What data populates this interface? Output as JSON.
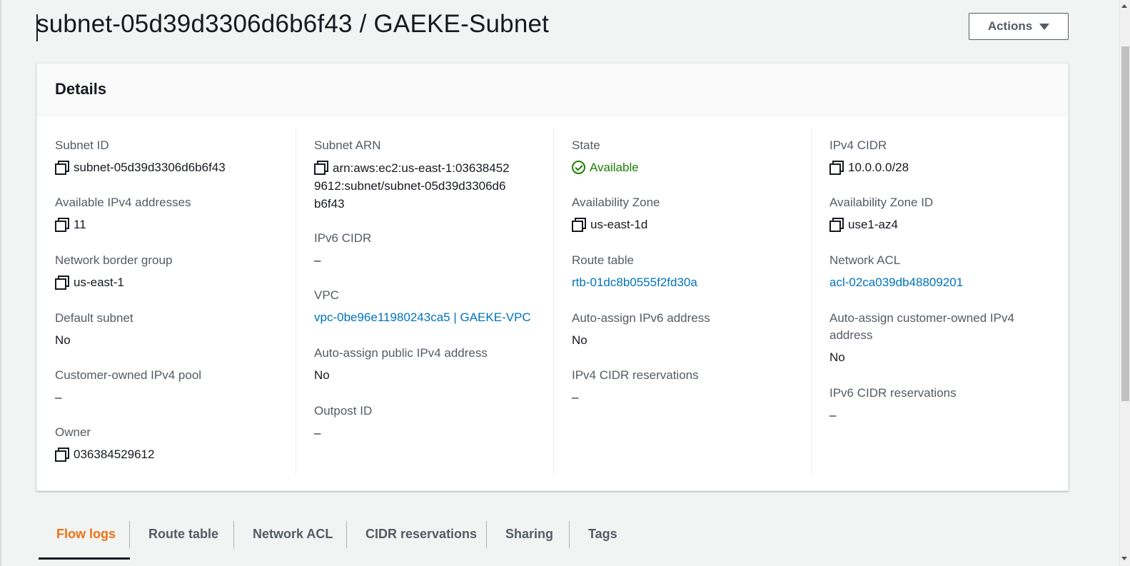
{
  "page": {
    "title": "subnet-05d39d3306d6b6f43 / GAEKE-Subnet",
    "actions_label": "Actions"
  },
  "details": {
    "header": "Details",
    "col1": {
      "subnet_id": {
        "label": "Subnet ID",
        "value": "subnet-05d39d3306d6b6f43"
      },
      "available_ipv4": {
        "label": "Available IPv4 addresses",
        "value": "11"
      },
      "network_border_group": {
        "label": "Network border group",
        "value": "us-east-1"
      },
      "default_subnet": {
        "label": "Default subnet",
        "value": "No"
      },
      "customer_owned_pool": {
        "label": "Customer-owned IPv4 pool",
        "value": "–"
      },
      "owner": {
        "label": "Owner",
        "value": "036384529612"
      }
    },
    "col2": {
      "subnet_arn": {
        "label": "Subnet ARN",
        "value": "arn:aws:ec2:us-east-1:036384529612:subnet/subnet-05d39d3306d6b6f43"
      },
      "ipv6_cidr": {
        "label": "IPv6 CIDR",
        "value": "–"
      },
      "vpc": {
        "label": "VPC",
        "value": "vpc-0be96e11980243ca5 | GAEKE-VPC"
      },
      "auto_assign_public_ipv4": {
        "label": "Auto-assign public IPv4 address",
        "value": "No"
      },
      "outpost_id": {
        "label": "Outpost ID",
        "value": "–"
      }
    },
    "col3": {
      "state": {
        "label": "State",
        "value": "Available"
      },
      "availability_zone": {
        "label": "Availability Zone",
        "value": "us-east-1d"
      },
      "route_table": {
        "label": "Route table",
        "value": "rtb-01dc8b0555f2fd30a"
      },
      "auto_assign_ipv6": {
        "label": "Auto-assign IPv6 address",
        "value": "No"
      },
      "ipv4_cidr_reservations": {
        "label": "IPv4 CIDR reservations",
        "value": "–"
      }
    },
    "col4": {
      "ipv4_cidr": {
        "label": "IPv4 CIDR",
        "value": "10.0.0.0/28"
      },
      "availability_zone_id": {
        "label": "Availability Zone ID",
        "value": "use1-az4"
      },
      "network_acl": {
        "label": "Network ACL",
        "value": "acl-02ca039db48809201"
      },
      "auto_assign_customer_owned": {
        "label": "Auto-assign customer-owned IPv4 address",
        "value": "No"
      },
      "ipv6_cidr_reservations": {
        "label": "IPv6 CIDR reservations",
        "value": "–"
      }
    }
  },
  "tabs": [
    {
      "label": "Flow logs",
      "active": true
    },
    {
      "label": "Route table"
    },
    {
      "label": "Network ACL"
    },
    {
      "label": "CIDR reservations"
    },
    {
      "label": "Sharing"
    },
    {
      "label": "Tags"
    }
  ],
  "colors": {
    "link": "#0073bb",
    "status_ok": "#1d8102",
    "active_tab": "#ec7211",
    "background": "#f2f3f3"
  },
  "icons": [
    "copy-icon",
    "status-check-icon",
    "dropdown-triangle-icon"
  ]
}
